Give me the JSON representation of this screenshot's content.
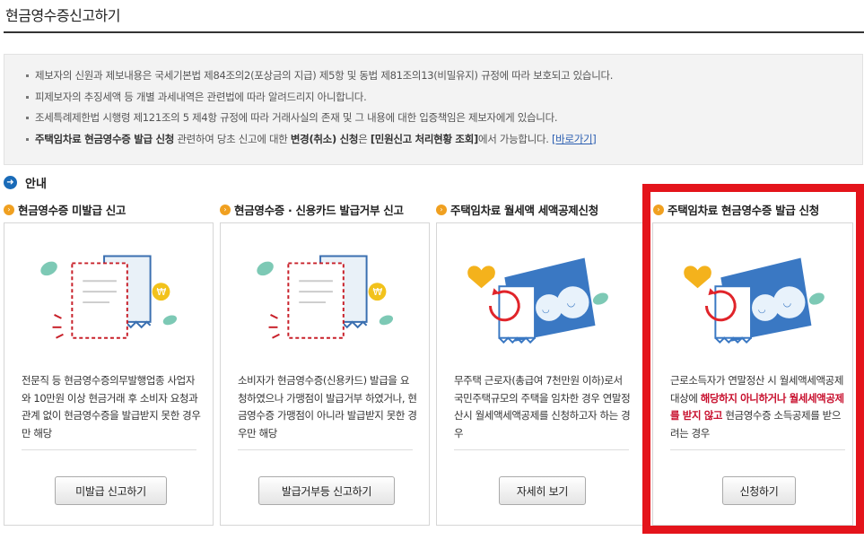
{
  "page": {
    "title": "현금영수증신고하기"
  },
  "notice": {
    "line1": "제보자의 신원과 제보내용은 국세기본법 제84조의2(포상금의 지급) 제5항 및 동법 제81조의13(비밀유지) 규정에 따라 보호되고 있습니다.",
    "line2": "피제보자의 추징세액 등 개별 과세내역은 관련법에 따라 알려드리지 아니합니다.",
    "line3": "조세특례제한법 시행령 제121조의 5 제4항 규정에 따라 거래사실의 존재 및 그 내용에 대한 입증책임은 제보자에게 있습니다.",
    "line4_part1": "주택임차료 현금영수증 발급 신청",
    "line4_part2": " 관련하여 당초 신고에 대한 ",
    "line4_part3": "변경(취소) 신청",
    "line4_part4": "은 ",
    "line4_part5": "[민원신고 처리현황 조회]",
    "line4_part6": "에서 가능합니다. ",
    "line4_link": "[바로가기]"
  },
  "guide": {
    "icon": "arrow-right-circle-icon",
    "glyph": "➜",
    "label": "안내"
  },
  "cards": [
    {
      "title": "현금영수증 미발급 신고",
      "desc": "전문직 등 현금영수증의무발행업종 사업자와 10만원 이상 현금거래 후 소비자 요청과 관계 없이 현금영수증을 발급받지 못한 경우만 해당",
      "button": "미발급 신고하기"
    },
    {
      "title": "현금영수증 · 신용카드 발급거부 신고",
      "desc": "소비자가 현금영수증(신용카드) 발급을 요청하였으나 가맹점이 발급거부 하였거나, 현금영수증 가맹점이 아니라 발급받지 못한 경우만 해당",
      "button": "발급거부등 신고하기"
    },
    {
      "title": "주택임차료 월세액 세액공제신청",
      "desc": "무주택 근로자(총급여 7천만원 이하)로서 국민주택규모의 주택을 임차한 경우 연말정산시 월세액세액공제를 신청하고자 하는 경우",
      "button": "자세히 보기"
    },
    {
      "title": "주택임차료 현금영수증 발급 신청",
      "desc_part1": "근로소득자가 연말정산 시 월세액세액공제 대상에 ",
      "desc_highlight": "해당하지 아니하거나 월세세액공제를 받지 않고",
      "desc_part2": " 현금영수증 소득공제를 받으려는 경우",
      "button": "신청하기"
    }
  ],
  "colors": {
    "highlight": "#e4141b",
    "accent_red": "#c8102e",
    "title_dot": "#f0a020",
    "guide_icon": "#1a6bb8"
  }
}
